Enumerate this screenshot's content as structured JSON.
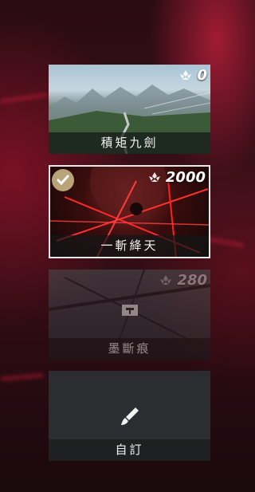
{
  "skills": [
    {
      "name": "積矩九劍",
      "cost": "0",
      "selected": false,
      "locked": false
    },
    {
      "name": "一斬絳天",
      "cost": "2000",
      "selected": true,
      "locked": false
    },
    {
      "name": "墨斷痕",
      "cost": "280",
      "selected": false,
      "locked": true
    },
    {
      "name": "自訂",
      "cost": "",
      "selected": false,
      "locked": false
    }
  ],
  "icons": {
    "cost_icon": "lotus-currency-icon",
    "selected_icon": "checkmark-icon",
    "custom_icon": "brush-icon"
  },
  "colors": {
    "selected_border": "#e8e8e8",
    "label_bg": "#141618",
    "check_bg": "#d2be8c"
  }
}
